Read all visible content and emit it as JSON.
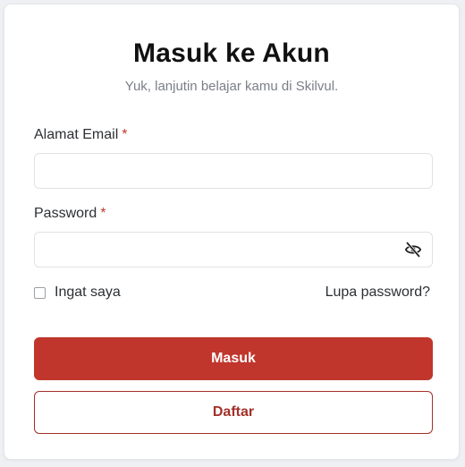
{
  "login": {
    "title": "Masuk ke Akun",
    "subtitle": "Yuk, lanjutin belajar kamu di Skilvul.",
    "email": {
      "label": "Alamat Email",
      "required_mark": "*",
      "value": "",
      "placeholder": ""
    },
    "password": {
      "label": "Password",
      "required_mark": "*",
      "value": "",
      "placeholder": "",
      "toggle_icon": "eye-slash-icon"
    },
    "remember_me": {
      "label": "Ingat saya",
      "checked": false
    },
    "forgot_password": "Lupa password?",
    "submit_label": "Masuk",
    "register_label": "Daftar"
  },
  "colors": {
    "primary": "#c0362c",
    "outline": "#a3302a",
    "required": "#c0392b",
    "muted_text": "#7a7f87",
    "border": "#dfe2e6"
  }
}
